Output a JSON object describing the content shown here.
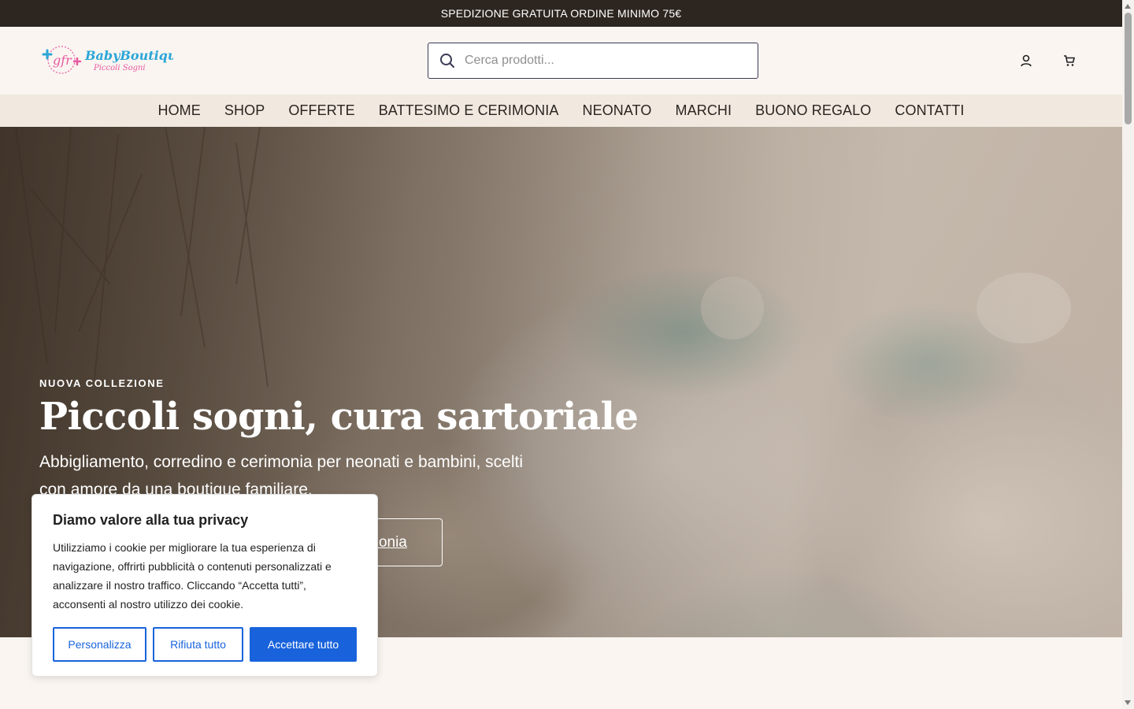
{
  "announcement": {
    "text": "SPEDIZIONE GRATUITA ORDINE MINIMO 75€"
  },
  "header": {
    "logo": {
      "mark": "gfr",
      "name": "BabyBoutique",
      "tagline": "Piccoli Sogni"
    },
    "search": {
      "placeholder": "Cerca prodotti...",
      "value": "",
      "icon": "search-icon"
    },
    "icons": [
      "account-icon",
      "cart-icon"
    ]
  },
  "nav": {
    "items": [
      {
        "label": "HOME"
      },
      {
        "label": "SHOP"
      },
      {
        "label": "OFFERTE"
      },
      {
        "label": "BATTESIMO E CERIMONIA"
      },
      {
        "label": "NEONATO"
      },
      {
        "label": "MARCHI"
      },
      {
        "label": "BUONO REGALO"
      },
      {
        "label": "CONTATTI"
      }
    ]
  },
  "hero": {
    "eyebrow": "NUOVA COLLEZIONE",
    "title": "Piccoli sogni, cura sartoriale",
    "subtitle": "Abbigliamento, corredino e cerimonia per neonati e bambini, scelti con amore da una boutique familiare.",
    "secondary_cta_visible": "monia"
  },
  "cookie_banner": {
    "title": "Diamo valore alla tua privacy",
    "body": "Utilizziamo i cookie per migliorare la tua esperienza di navigazione, offrirti pubblicità o contenuti personalizzati e analizzare il nostro traffico. Cliccando “Accetta tutti”, acconsenti al nostro utilizzo dei cookie.",
    "customize_label": "Personalizza",
    "reject_label": "Rifiuta tutto",
    "accept_label": "Accettare tutto"
  },
  "colors": {
    "announcement_bg": "#2d2620",
    "page_bg": "#faf5f1",
    "nav_bg": "#f1e9e0",
    "cookie_accent": "#1863dc",
    "logo_blue": "#2aa6d8",
    "logo_pink": "#e85aa0"
  }
}
